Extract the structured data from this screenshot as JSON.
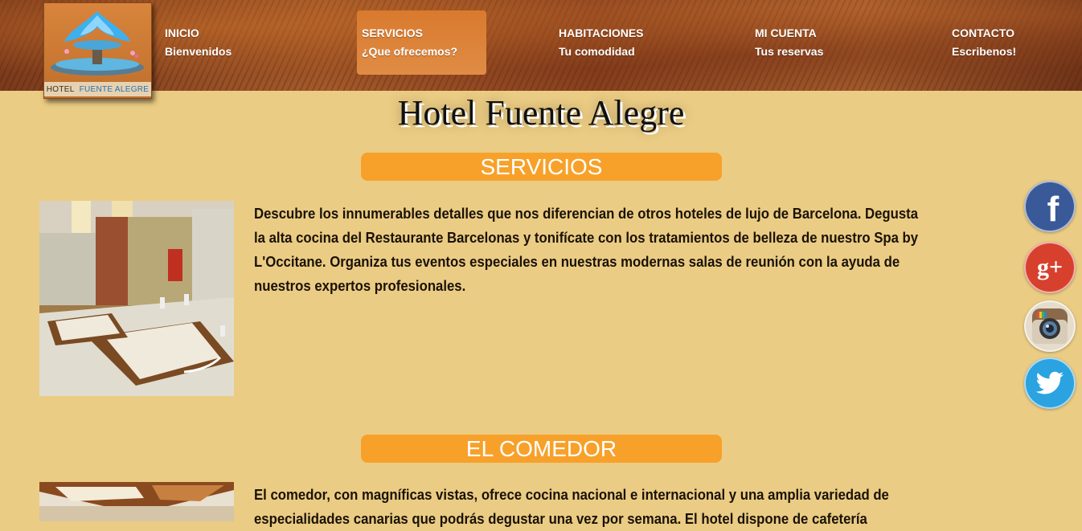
{
  "logo": {
    "word1": "HOTEL",
    "word2": "FUENTE ALEGRE"
  },
  "nav": [
    {
      "label": "INICIO",
      "sub": "Bienvenidos"
    },
    {
      "label": "SERVICIOS",
      "sub": "¿Que ofrecemos?"
    },
    {
      "label": "HABITACIONES",
      "sub": "Tu comodidad"
    },
    {
      "label": "MI CUENTA",
      "sub": "Tus reservas"
    },
    {
      "label": "CONTACTO",
      "sub": "Escribenos!"
    }
  ],
  "site_title": "Hotel Fuente Alegre",
  "sections": [
    {
      "heading": "SERVICIOS",
      "text": "Descubre los innumerables detalles que nos diferencian de otros hoteles de lujo de Barcelona. Degusta la alta cocina del Restaurante Barcelonas y tonifícate con los tratamientos de belleza de nuestro Spa by L'Occitane. Organiza tus eventos especiales en nuestras modernas salas de reunión con la ayuda de nuestros expertos profesionales."
    },
    {
      "heading": "EL COMEDOR",
      "text": "El comedor, con magníficas vistas, ofrece cocina nacional e internacional y una amplia variedad de especialidades canarias que podrás degustar una vez por semana. El hotel dispone de cafetería"
    }
  ],
  "social": {
    "facebook_glyph": "f",
    "googleplus_glyph": "g+",
    "icons": [
      "facebook-icon",
      "google-plus-icon",
      "instagram-icon",
      "twitter-icon"
    ],
    "colors": {
      "facebook": "#3a5998",
      "googleplus": "#d8402e",
      "twitter": "#2aa3e0"
    }
  },
  "colors": {
    "page_bg": "#ebcc84",
    "section_bar": "#f7a12a",
    "nav_active": "#d87a2e"
  }
}
